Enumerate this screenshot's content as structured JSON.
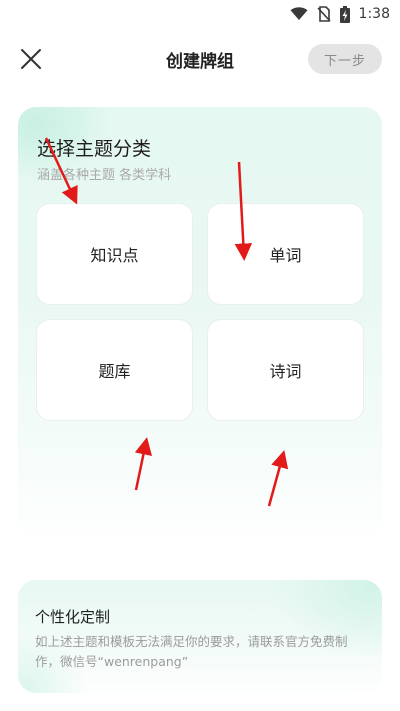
{
  "status_bar": {
    "time": "1:38",
    "icons": [
      "wifi-icon",
      "no-sim-icon",
      "battery-charging-icon"
    ]
  },
  "nav": {
    "close_icon": "close-icon",
    "title": "创建牌组",
    "next_label": "下一步"
  },
  "category_section": {
    "title": "选择主题分类",
    "subtitle": "涵盖各种主题 各类学科",
    "cards": [
      {
        "label": "知识点"
      },
      {
        "label": "单词"
      },
      {
        "label": "题库"
      },
      {
        "label": "诗词"
      }
    ]
  },
  "custom_section": {
    "title": "个性化定制",
    "description": "如上述主题和模板无法满足你的要求，请联系官方免费制作，微信号“wenrenpang”"
  },
  "colors": {
    "accent_light": "#e5f8f2",
    "next_button_bg": "#e4e4e4",
    "annotation_arrow": "#e21a1a"
  }
}
